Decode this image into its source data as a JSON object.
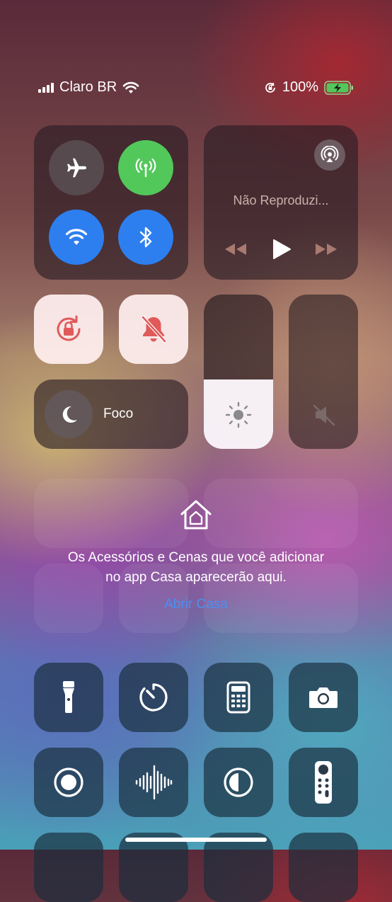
{
  "status_bar": {
    "carrier": "Claro BR",
    "battery": "100%"
  },
  "connectivity": {
    "airplane": "off",
    "cellular": "on",
    "wifi": "on",
    "bluetooth": "on"
  },
  "now_playing": {
    "title": "Não Reproduzi..."
  },
  "focus": {
    "label": "Foco"
  },
  "brightness_level": 0.45,
  "volume_level": 0.0,
  "home": {
    "message_line1": "Os Acessórios e Cenas que você adicionar",
    "message_line2": "no app Casa aparecerão aqui.",
    "link": "Abrir Casa"
  },
  "colors": {
    "green": "#52c85a",
    "blue": "#2d7ff0",
    "red_icon": "#e05a5a",
    "link": "#4a8ff5"
  }
}
